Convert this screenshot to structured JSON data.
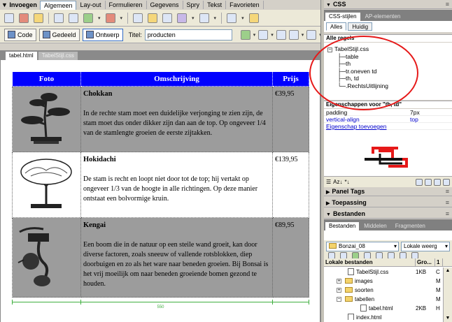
{
  "insert_bar": {
    "title": "Invoegen",
    "tabs": [
      "Algemeen",
      "Lay-out",
      "Formulieren",
      "Gegevens",
      "Spry",
      "Tekst",
      "Favorieten"
    ],
    "active_tab": "Algemeen"
  },
  "doc_toolbar": {
    "code_label": "Code",
    "split_label": "Gedeeld",
    "design_label": "Ontwerp",
    "title_label": "Titel:",
    "title_value": "producten"
  },
  "doc_tabs": [
    "tabel.html",
    "TabelStijl.css"
  ],
  "table": {
    "headers": [
      "Foto",
      "Omschrijving",
      "Prijs"
    ],
    "rows": [
      {
        "name": "Chokkan",
        "desc": "In de rechte stam moet een duidelijke verjonging te zien zijn, de stam moet dus onder dikker zijn dan aan de top. Op ongeveer 1/4 van de stamlengte groeien de eerste zijtakken.",
        "price": "€39,95"
      },
      {
        "name": "Hokidachi",
        "desc": "De stam is recht en loopt niet door tot de top; hij vertakt op ongeveer 1/3 van de hoogte in alle richtingen. Op deze manier ontstaat een bolvormige kruin.",
        "price": "€139,95"
      },
      {
        "name": "Kengai",
        "desc": "Een boom die in de natuur op een steile wand groeit, kan door diverse factoren, zoals sneeuw of vallende rotsblokken, diep doorbuigen en zo als het ware naar beneden groeien. Bij Bonsai is het vrij moeilijk om naar beneden groeiende bomen gezond te houden.",
        "price": "€89,95"
      }
    ],
    "width_label": "550"
  },
  "css_panel": {
    "header": "CSS",
    "tabs": [
      "CSS-stijlen",
      "AP-elementen"
    ],
    "modes": [
      "Alles",
      "Huidig"
    ],
    "all_rules_label": "Alle regels",
    "stylesheet": "TabelStijl.css",
    "rules": [
      "table",
      "th",
      "tr.oneven td",
      "th, td",
      ".RechtsUitlijning"
    ],
    "props_header": "Eigenschappen voor \"th, td\"",
    "props": [
      {
        "name": "padding",
        "value": "7px"
      },
      {
        "name": "vertical-align",
        "value": "top"
      }
    ],
    "add_prop_label": "Eigenschap toevoegen"
  },
  "collapsed_panels": [
    "Panel Tags",
    "Toepassing"
  ],
  "files_panel": {
    "header": "Bestanden",
    "tabs": [
      "Bestanden",
      "Middelen",
      "Fragmenten"
    ],
    "site": "Bonzai_08",
    "view": "Lokale weerg",
    "col_name": "Lokale bestanden",
    "col_size": "Gro...",
    "col_extra": "1",
    "items": [
      {
        "name": "TabelStijl.css",
        "size": "1KB",
        "extra": "C"
      },
      {
        "name": "images",
        "size": "",
        "extra": "M"
      },
      {
        "name": "soorten",
        "size": "",
        "extra": "M"
      },
      {
        "name": "tabellen",
        "size": "",
        "extra": "M"
      },
      {
        "name": "tabel.html",
        "size": "2KB",
        "extra": "H"
      },
      {
        "name": "index.html",
        "size": "",
        "extra": ""
      }
    ]
  },
  "colors": {
    "header_blue": "#0000ff",
    "odd_row": "#9c9c9c",
    "annotation": "#e61919",
    "guide": "#3fae3f"
  }
}
